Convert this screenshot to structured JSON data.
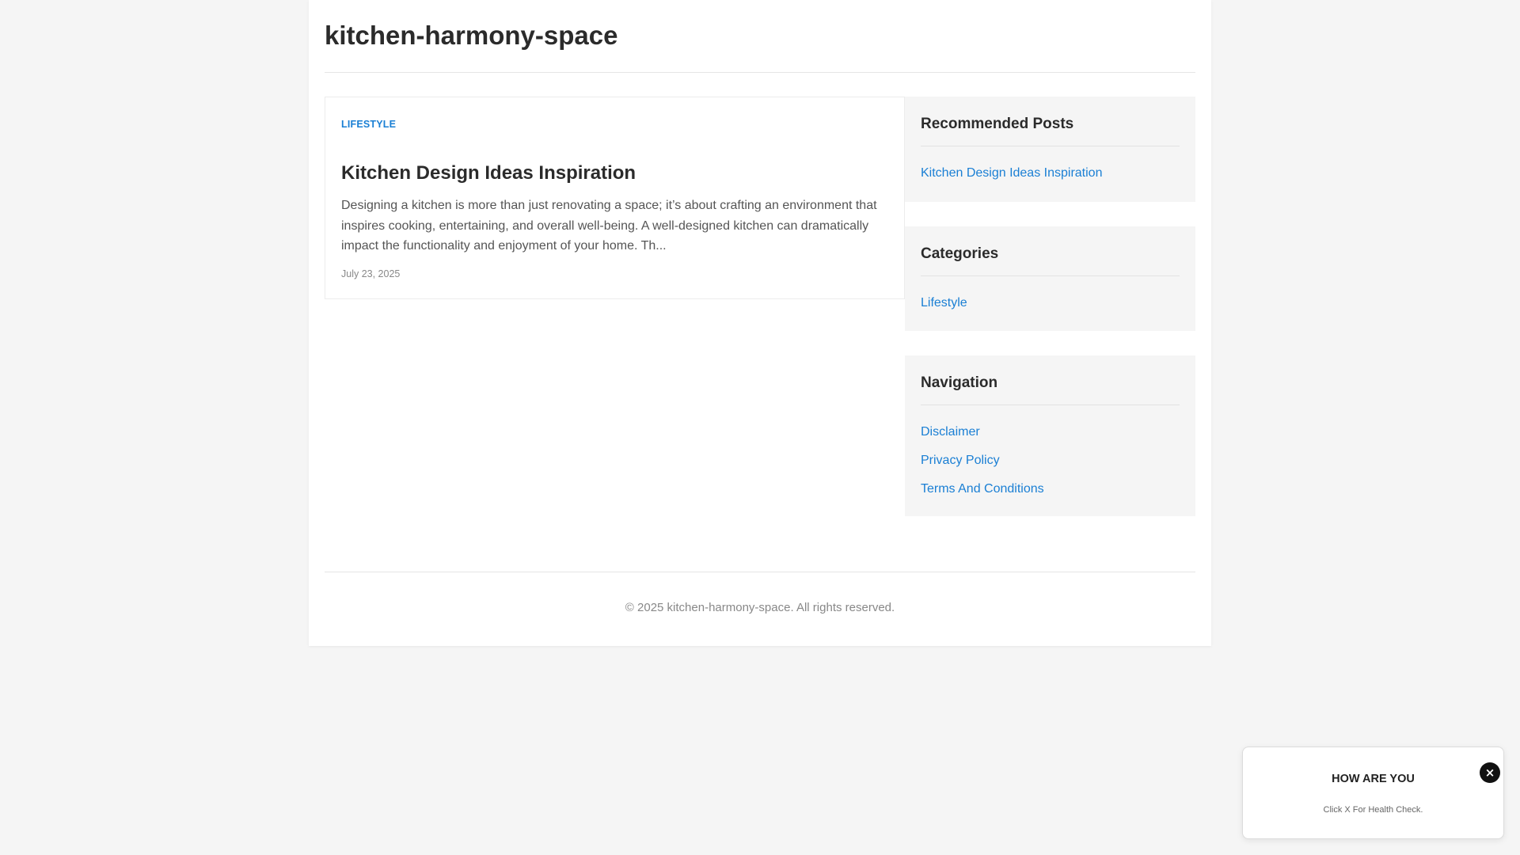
{
  "site": {
    "title": "kitchen-harmony-space"
  },
  "post": {
    "category": "LIFESTYLE",
    "title": "Kitchen Design Ideas Inspiration",
    "excerpt": "Designing a kitchen is more than just renovating a space; it’s about crafting an environment that inspires cooking, entertaining, and overall well-being. A well-designed kitchen can dramatically impact the functionality and enjoyment of your home. Th...",
    "date": "July 23, 2025"
  },
  "sidebar": {
    "recommended": {
      "title": "Recommended Posts",
      "items": [
        "Kitchen Design Ideas Inspiration"
      ]
    },
    "categories": {
      "title": "Categories",
      "items": [
        "Lifestyle"
      ]
    },
    "navigation": {
      "title": "Navigation",
      "items": [
        "Disclaimer",
        "Privacy Policy",
        "Terms And Conditions"
      ]
    }
  },
  "footer": {
    "text": "© 2025 kitchen-harmony-space. All rights reserved."
  },
  "popup": {
    "title": "HOW ARE YOU",
    "text": "Click X For Health Check.",
    "close_label": "×"
  },
  "colors": {
    "accent": "#1a7fd4",
    "page_background": "#f5f5f5",
    "card_background": "#ffffff"
  }
}
